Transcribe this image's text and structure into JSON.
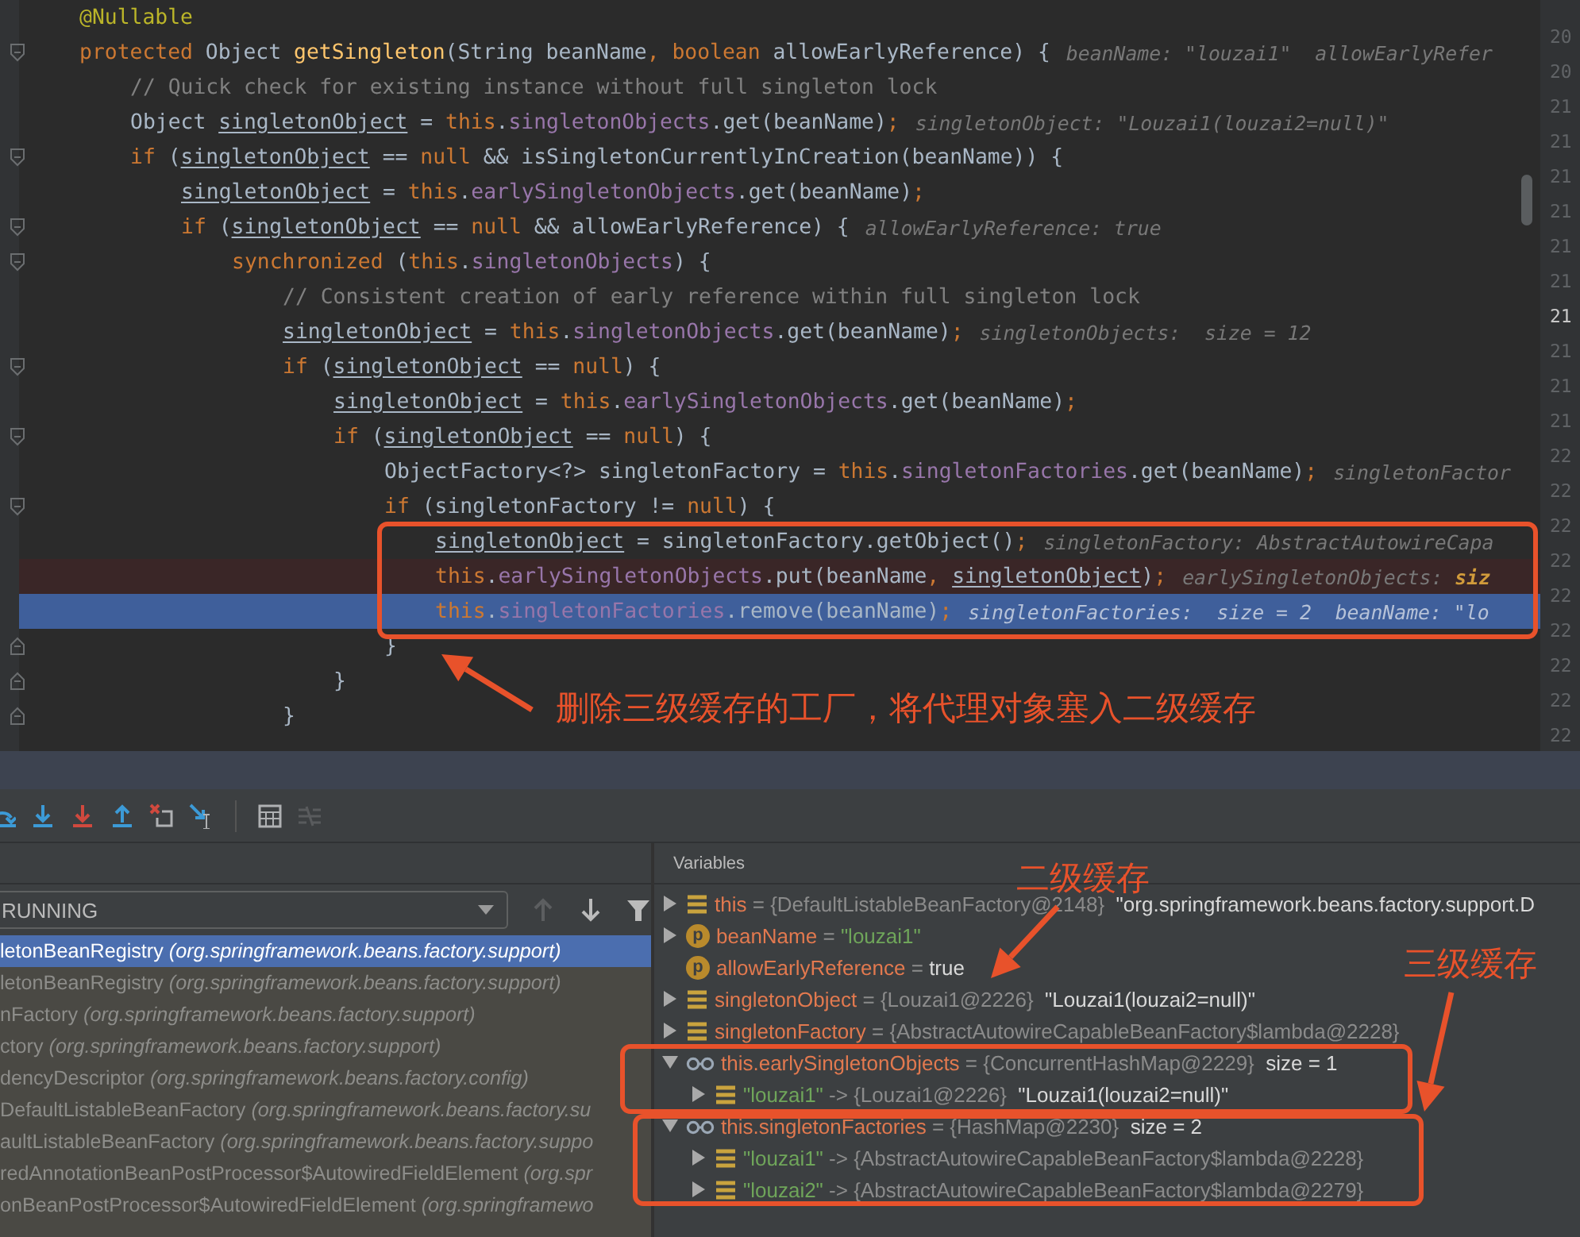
{
  "editor": {
    "lines": [
      {
        "tokens": [
          {
            "kind": "anno",
            "text": "@Nullable"
          }
        ]
      },
      {
        "fold_marker": true,
        "tokens": [
          {
            "kind": "kw",
            "text": "protected"
          },
          {
            "kind": "plain",
            "text": " Object "
          },
          {
            "kind": "method",
            "text": "getSingleton"
          },
          {
            "kind": "plain",
            "text": "(String beanName"
          },
          {
            "kind": "kw",
            "text": ", boolean"
          },
          {
            "kind": "plain",
            "text": " allowEarlyReference) {"
          }
        ],
        "hint": "beanName: \"louzai1\"  allowEarlyRefer",
        "children": [
          {
            "tokens": [
              {
                "kind": "comment",
                "text": "// Quick check for existing instance without full singleton lock"
              }
            ]
          },
          {
            "tokens": [
              {
                "kind": "plain",
                "text": "Object "
              },
              {
                "kind": "var",
                "text": "singletonObject"
              },
              {
                "kind": "plain",
                "text": " = "
              },
              {
                "kind": "kw",
                "text": "this"
              },
              {
                "kind": "plain",
                "text": "."
              },
              {
                "kind": "field",
                "text": "singletonObjects"
              },
              {
                "kind": "plain",
                "text": ".get(beanName)"
              },
              {
                "kind": "kw",
                "text": ";"
              }
            ],
            "hint": "singletonObject: \"Louzai1(louzai2=null)\""
          },
          {
            "fold_marker": true,
            "tokens": [
              {
                "kind": "kw",
                "text": "if"
              },
              {
                "kind": "plain",
                "text": " ("
              },
              {
                "kind": "var",
                "text": "singletonObject"
              },
              {
                "kind": "plain",
                "text": " == "
              },
              {
                "kind": "kw",
                "text": "null"
              },
              {
                "kind": "plain",
                "text": " && isSingletonCurrentlyInCreation(beanName)) {"
              }
            ],
            "children": [
              {
                "tokens": [
                  {
                    "kind": "var",
                    "text": "singletonObject"
                  },
                  {
                    "kind": "plain",
                    "text": " = "
                  },
                  {
                    "kind": "kw",
                    "text": "this"
                  },
                  {
                    "kind": "plain",
                    "text": "."
                  },
                  {
                    "kind": "field",
                    "text": "earlySingletonObjects"
                  },
                  {
                    "kind": "plain",
                    "text": ".get(beanName)"
                  },
                  {
                    "kind": "kw",
                    "text": ";"
                  }
                ]
              },
              {
                "fold_marker": true,
                "tokens": [
                  {
                    "kind": "kw",
                    "text": "if"
                  },
                  {
                    "kind": "plain",
                    "text": " ("
                  },
                  {
                    "kind": "var",
                    "text": "singletonObject"
                  },
                  {
                    "kind": "plain",
                    "text": " == "
                  },
                  {
                    "kind": "kw",
                    "text": "null"
                  },
                  {
                    "kind": "plain",
                    "text": " && allowEarlyReference) {"
                  }
                ],
                "hint": "allowEarlyReference: true",
                "children": [
                  {
                    "fold_marker": true,
                    "tokens": [
                      {
                        "kind": "kw",
                        "text": "synchronized"
                      },
                      {
                        "kind": "plain",
                        "text": " ("
                      },
                      {
                        "kind": "kw",
                        "text": "this"
                      },
                      {
                        "kind": "plain",
                        "text": "."
                      },
                      {
                        "kind": "field",
                        "text": "singletonObjects"
                      },
                      {
                        "kind": "plain",
                        "text": ") {"
                      }
                    ],
                    "children": [
                      {
                        "tokens": [
                          {
                            "kind": "comment",
                            "text": "// Consistent creation of early reference within full singleton lock"
                          }
                        ]
                      },
                      {
                        "tokens": [
                          {
                            "kind": "var",
                            "text": "singletonObject"
                          },
                          {
                            "kind": "plain",
                            "text": " = "
                          },
                          {
                            "kind": "kw",
                            "text": "this"
                          },
                          {
                            "kind": "plain",
                            "text": "."
                          },
                          {
                            "kind": "field",
                            "text": "singletonObjects"
                          },
                          {
                            "kind": "plain",
                            "text": ".get(beanName)"
                          },
                          {
                            "kind": "kw",
                            "text": ";"
                          }
                        ],
                        "hint": "singletonObjects:  size = 12"
                      },
                      {
                        "fold_marker": true,
                        "tokens": [
                          {
                            "kind": "kw",
                            "text": "if"
                          },
                          {
                            "kind": "plain",
                            "text": " ("
                          },
                          {
                            "kind": "var",
                            "text": "singletonObject"
                          },
                          {
                            "kind": "plain",
                            "text": " == "
                          },
                          {
                            "kind": "kw",
                            "text": "null"
                          },
                          {
                            "kind": "plain",
                            "text": ") {"
                          }
                        ],
                        "children": [
                          {
                            "tokens": [
                              {
                                "kind": "var",
                                "text": "singletonObject"
                              },
                              {
                                "kind": "plain",
                                "text": " = "
                              },
                              {
                                "kind": "kw",
                                "text": "this"
                              },
                              {
                                "kind": "plain",
                                "text": "."
                              },
                              {
                                "kind": "field",
                                "text": "earlySingletonObjects"
                              },
                              {
                                "kind": "plain",
                                "text": ".get(beanName)"
                              },
                              {
                                "kind": "kw",
                                "text": ";"
                              }
                            ]
                          },
                          {
                            "fold_marker": true,
                            "tokens": [
                              {
                                "kind": "kw",
                                "text": "if"
                              },
                              {
                                "kind": "plain",
                                "text": " ("
                              },
                              {
                                "kind": "var",
                                "text": "singletonObject"
                              },
                              {
                                "kind": "plain",
                                "text": " == "
                              },
                              {
                                "kind": "kw",
                                "text": "null"
                              },
                              {
                                "kind": "plain",
                                "text": ") {"
                              }
                            ],
                            "children": [
                              {
                                "tokens": [
                                  {
                                    "kind": "plain",
                                    "text": "ObjectFactory<?> singletonFactory = "
                                  },
                                  {
                                    "kind": "kw",
                                    "text": "this"
                                  },
                                  {
                                    "kind": "plain",
                                    "text": "."
                                  },
                                  {
                                    "kind": "field",
                                    "text": "singletonFactories"
                                  },
                                  {
                                    "kind": "plain",
                                    "text": ".get(beanName)"
                                  },
                                  {
                                    "kind": "kw",
                                    "text": ";"
                                  }
                                ],
                                "hint": "singletonFactor"
                              },
                              {
                                "fold_marker": true,
                                "tokens": [
                                  {
                                    "kind": "kw",
                                    "text": "if"
                                  },
                                  {
                                    "kind": "plain",
                                    "text": " (singletonFactory != "
                                  },
                                  {
                                    "kind": "kw",
                                    "text": "null"
                                  },
                                  {
                                    "kind": "plain",
                                    "text": ") {"
                                  }
                                ],
                                "children": [
                                  {
                                    "tokens": [
                                      {
                                        "kind": "var",
                                        "text": "singletonObject"
                                      },
                                      {
                                        "kind": "plain",
                                        "text": " = singletonFactory.getObject()"
                                      },
                                      {
                                        "kind": "kw",
                                        "text": ";"
                                      }
                                    ],
                                    "hint": "singletonFactory: AbstractAutowireCapa"
                                  },
                                  {
                                    "breakpoint": true,
                                    "tokens": [
                                      {
                                        "kind": "kw",
                                        "text": "this"
                                      },
                                      {
                                        "kind": "plain",
                                        "text": "."
                                      },
                                      {
                                        "kind": "field",
                                        "text": "earlySingletonObjects"
                                      },
                                      {
                                        "kind": "plain",
                                        "text": ".put(beanName"
                                      },
                                      {
                                        "kind": "kw",
                                        "text": ", "
                                      },
                                      {
                                        "kind": "var",
                                        "text": "singletonObject"
                                      },
                                      {
                                        "kind": "plain",
                                        "text": ")"
                                      },
                                      {
                                        "kind": "kw",
                                        "text": ";"
                                      }
                                    ],
                                    "hint": "earlySingletonObjects:",
                                    "hint_changed": "siz"
                                  },
                                  {
                                    "execution_point": true,
                                    "tokens": [
                                      {
                                        "kind": "kw",
                                        "text": "this"
                                      },
                                      {
                                        "kind": "plain",
                                        "text": "."
                                      },
                                      {
                                        "kind": "field",
                                        "text": "singletonFactories"
                                      },
                                      {
                                        "kind": "plain",
                                        "text": ".remove(beanName)"
                                      },
                                      {
                                        "kind": "kw",
                                        "text": ";"
                                      }
                                    ],
                                    "hint": "singletonFactories:  size = 2  beanName: \"lo"
                                  }
                                ]
                              },
                              {
                                "fold_marker": true,
                                "tokens": [
                                  {
                                    "kind": "plain",
                                    "text": "}"
                                  }
                                ]
                              }
                            ]
                          },
                          {
                            "fold_marker": true,
                            "tokens": [
                              {
                                "kind": "plain",
                                "text": "}"
                              }
                            ]
                          }
                        ]
                      },
                      {
                        "fold_marker": true,
                        "tokens": [
                          {
                            "kind": "plain",
                            "text": "}"
                          }
                        ]
                      }
                    ]
                  }
                ]
              }
            ]
          }
        ]
      }
    ],
    "line_numbers": [
      {
        "text": "20",
        "current": false
      },
      {
        "text": "20",
        "current": false
      },
      {
        "text": "21",
        "current": false
      },
      {
        "text": "21",
        "current": false
      },
      {
        "text": "21",
        "current": false
      },
      {
        "text": "21",
        "current": false
      },
      {
        "text": "21",
        "current": false
      },
      {
        "text": "21",
        "current": false
      },
      {
        "text": "21",
        "current": true
      },
      {
        "text": "21",
        "current": false
      },
      {
        "text": "21",
        "current": false
      },
      {
        "text": "21",
        "current": false
      },
      {
        "text": "22",
        "current": false
      },
      {
        "text": "22",
        "current": false
      },
      {
        "text": "22",
        "current": false
      },
      {
        "text": "22",
        "current": false
      },
      {
        "text": "22",
        "current": false
      },
      {
        "text": "22",
        "current": false
      },
      {
        "text": "22",
        "current": false
      },
      {
        "text": "22",
        "current": false
      },
      {
        "text": "22",
        "current": false
      }
    ]
  },
  "debugger": {
    "toolbar": [
      {
        "kind": "step-over"
      },
      {
        "kind": "step-into"
      },
      {
        "kind": "force-step-into"
      },
      {
        "kind": "step-out"
      },
      {
        "kind": "drop-frame"
      },
      {
        "kind": "run-to-cursor"
      },
      {
        "kind": "divider"
      },
      {
        "kind": "evaluate",
        "disabled": false
      },
      {
        "kind": "trace",
        "disabled": true
      }
    ],
    "thread": {
      "value": "RUNNING"
    },
    "frames": [
      {
        "method": "letonBeanRegistry",
        "package": "(org.springframework.beans.factory.support)",
        "selected": true
      },
      {
        "method": "letonBeanRegistry",
        "package": "(org.springframework.beans.factory.support)",
        "selected": false
      },
      {
        "method": "nFactory",
        "package": "(org.springframework.beans.factory.support)",
        "selected": false
      },
      {
        "method": "ctory",
        "package": "(org.springframework.beans.factory.support)",
        "selected": false
      },
      {
        "method": "dencyDescriptor",
        "package": "(org.springframework.beans.factory.config)",
        "selected": false
      },
      {
        "method": "DefaultListableBeanFactory",
        "package": "(org.springframework.beans.factory.su",
        "selected": false
      },
      {
        "method": "aultListableBeanFactory",
        "package": "(org.springframework.beans.factory.suppo",
        "selected": false
      },
      {
        "method": "redAnnotationBeanPostProcessor$AutowiredFieldElement",
        "package": "(org.spr",
        "selected": false
      },
      {
        "method": "onBeanPostProcessor$AutowiredFieldElement",
        "package": "(org.springframewo",
        "selected": false
      }
    ],
    "variables": {
      "title": "Variables",
      "items": [
        {
          "kind": "field",
          "expanded": false,
          "name": "this",
          "sep": " = ",
          "type": "{DefaultListableBeanFactory@2148}",
          "value": "\"org.springframework.beans.factory.support.D"
        },
        {
          "kind": "param",
          "badge": "p",
          "expanded": false,
          "name": "beanName",
          "sep": " = ",
          "string": "\"louzai1\""
        },
        {
          "kind": "param",
          "badge": "p",
          "name": "allowEarlyReference",
          "sep": " = ",
          "value": "true"
        },
        {
          "kind": "field",
          "expanded": false,
          "name": "singletonObject",
          "sep": " = ",
          "type": "{Louzai1@2226}",
          "value": "\"Louzai1(louzai2=null)\""
        },
        {
          "kind": "field",
          "expanded": false,
          "name": "singletonFactory",
          "sep": " = ",
          "type": "{AbstractAutowireCapableBeanFactory$lambda@2228}"
        },
        {
          "kind": "watch",
          "expanded": true,
          "name": "this.earlySingletonObjects",
          "sep": " = ",
          "type": "{ConcurrentHashMap@2229}",
          "value": "size = 1",
          "children": [
            {
              "kind": "field",
              "expanded": false,
              "key": "\"louzai1\"",
              "sep": " -> ",
              "type": "{Louzai1@2226}",
              "value": "\"Louzai1(louzai2=null)\""
            }
          ]
        },
        {
          "kind": "watch",
          "expanded": true,
          "name": "this.singletonFactories",
          "sep": " = ",
          "type": "{HashMap@2230}",
          "value": "size = 2",
          "children": [
            {
              "kind": "field",
              "expanded": false,
              "key": "\"louzai1\"",
              "sep": " -> ",
              "type": "{AbstractAutowireCapableBeanFactory$lambda@2228}"
            },
            {
              "kind": "field",
              "expanded": false,
              "key": "\"louzai2\"",
              "sep": " -> ",
              "type": "{AbstractAutowireCapableBeanFactory$lambda@2279}"
            }
          ]
        }
      ]
    }
  },
  "annotations": [
    {
      "text": "删除三级缓存的工厂，将代理对象塞入二级缓存"
    },
    {
      "text": "二级缓存"
    },
    {
      "text": "三级缓存"
    }
  ]
}
